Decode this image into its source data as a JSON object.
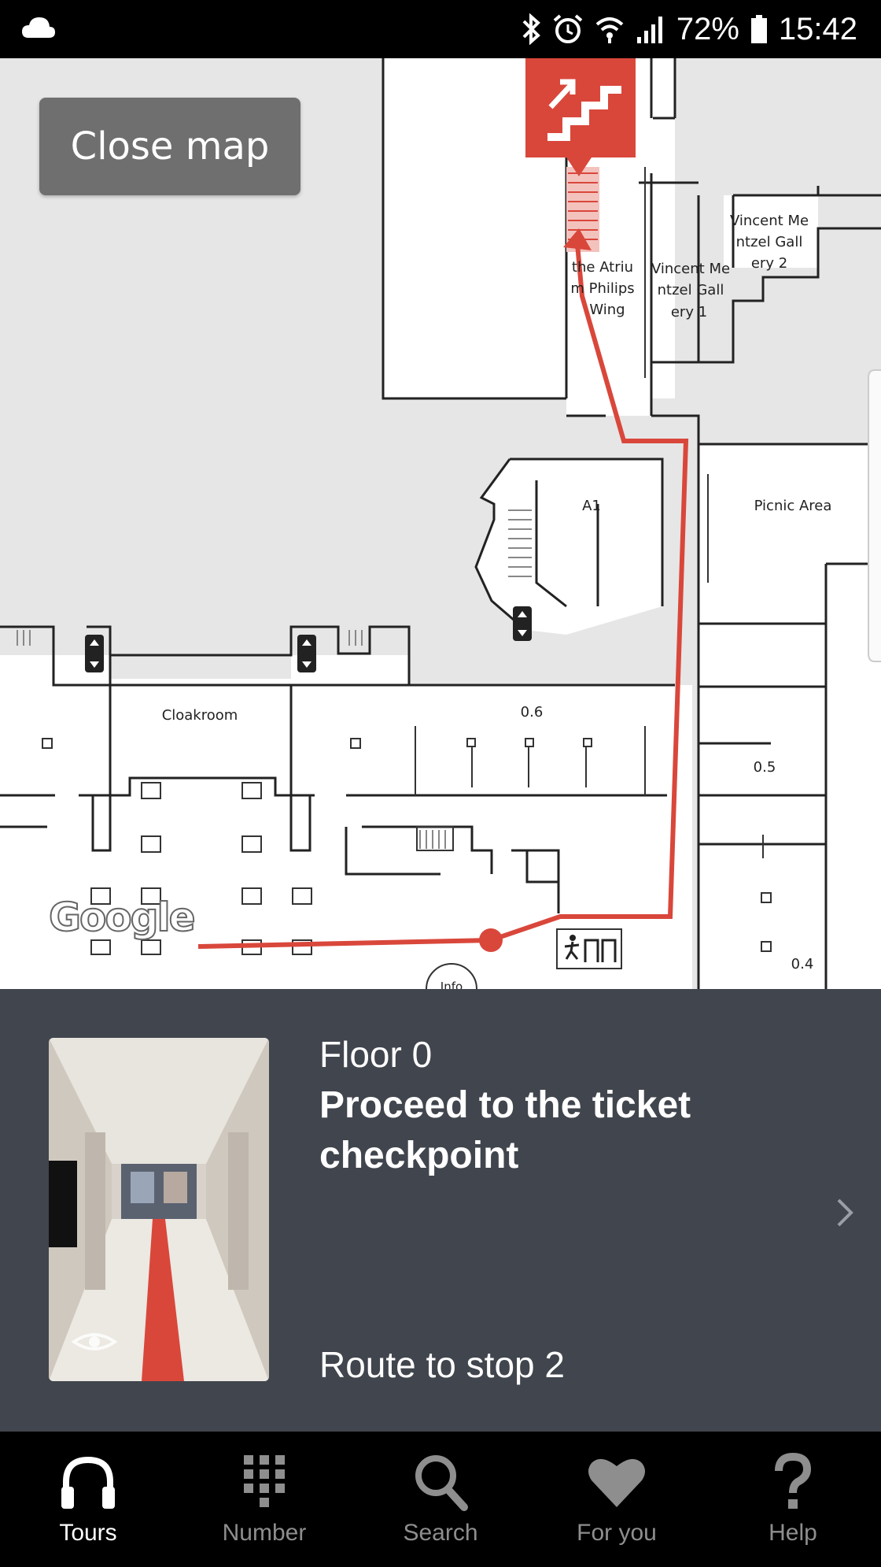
{
  "status_bar": {
    "battery": "72%",
    "time": "15:42",
    "icons": [
      "cloud-icon",
      "bluetooth-icon",
      "alarm-icon",
      "wifi-icon",
      "signal-icon",
      "battery-icon"
    ]
  },
  "map": {
    "close_label": "Close map",
    "google_logo": "Google",
    "rooms": {
      "atrium": [
        "the Atriu",
        "m Philips",
        "Wing"
      ],
      "gallery1": [
        "Vincent Me",
        "ntzel Gall",
        "ery 1"
      ],
      "gallery2": [
        "Vincent Me",
        "ntzel Gall",
        "ery 2"
      ],
      "a1": "A1",
      "picnic": "Picnic Area",
      "cloakroom": "Cloakroom",
      "r06": "0.6",
      "r05": "0.5",
      "r04": "0.4",
      "info": "Info"
    },
    "route_color": "#d9473b",
    "marker_icon": "stairs-up-icon"
  },
  "panel": {
    "floor": "Floor 0",
    "title_line1": "Proceed to the ticket",
    "title_line2": "checkpoint",
    "route": "Route to stop 2",
    "photo_icon": "eye-icon",
    "background": "#41454d"
  },
  "nav": [
    {
      "label": "Tours",
      "icon": "headphones-icon",
      "active": true
    },
    {
      "label": "Number",
      "icon": "keypad-icon",
      "active": false
    },
    {
      "label": "Search",
      "icon": "search-icon",
      "active": false
    },
    {
      "label": "For you",
      "icon": "heart-icon",
      "active": false
    },
    {
      "label": "Help",
      "icon": "help-icon",
      "active": false
    }
  ]
}
